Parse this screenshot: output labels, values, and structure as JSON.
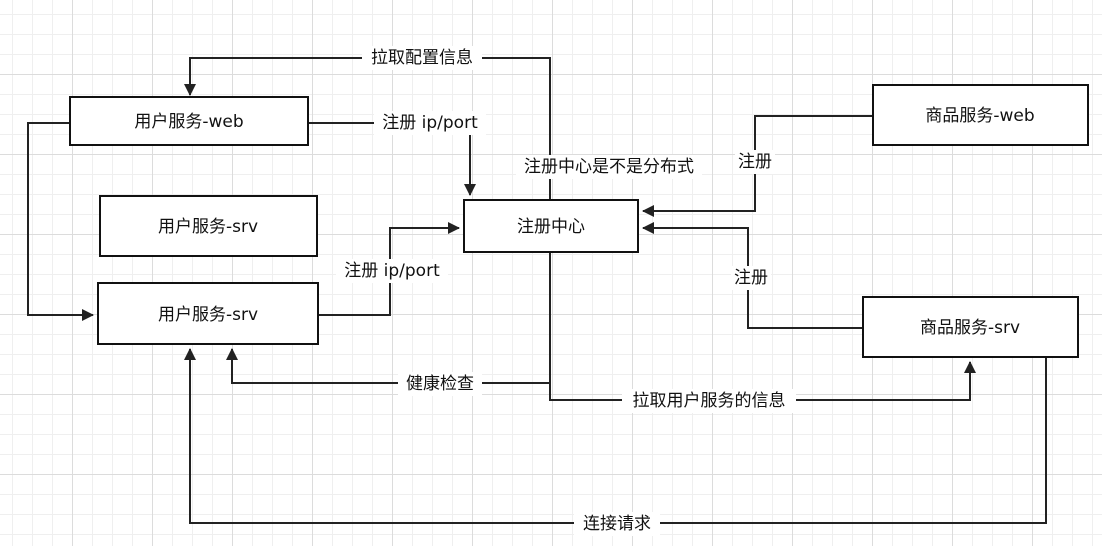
{
  "nodes": {
    "user_web": "用户服务-web",
    "user_srv_top": "用户服务-srv",
    "user_srv": "用户服务-srv",
    "registry": "注册中心",
    "goods_web": "商品服务-web",
    "goods_srv": "商品服务-srv"
  },
  "edges": {
    "pull_config": "拉取配置信息",
    "register_ip_port_web": "注册 ip/port",
    "registry_distributed_q": "注册中心是不是分布式",
    "register_goods_web": "注册",
    "register_ip_port_srv": "注册 ip/port",
    "register_goods_srv": "注册",
    "health_check": "健康检查",
    "pull_user_service_info": "拉取用户服务的信息",
    "connect_request": "连接请求"
  }
}
